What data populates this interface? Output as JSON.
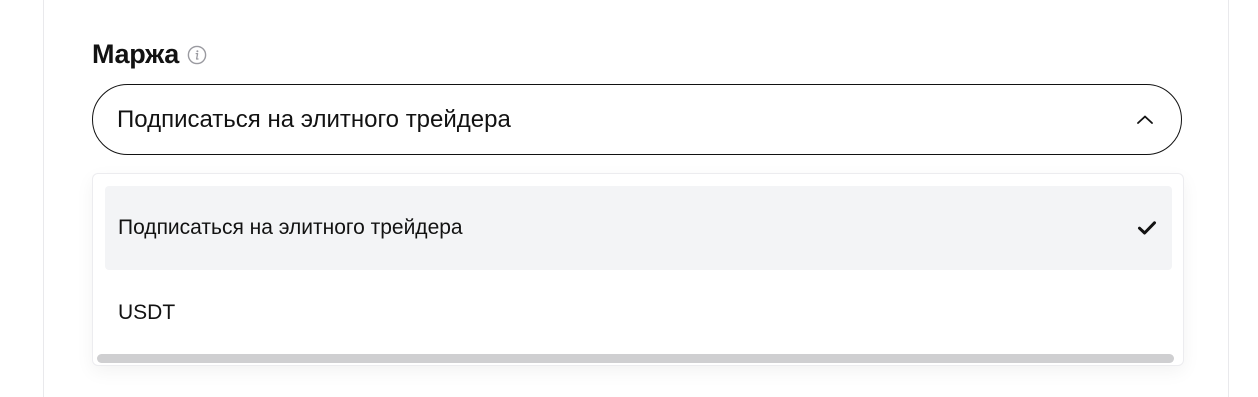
{
  "field": {
    "label": "Маржа",
    "info_icon": "info-icon",
    "selected_value": "Подписаться на элитного трейдера",
    "chevron_icon": "chevron-up-icon"
  },
  "dropdown": {
    "options": [
      {
        "label": "Подписаться на элитного трейдера",
        "selected": true,
        "icon": "check-icon"
      },
      {
        "label": "USDT",
        "selected": false
      }
    ]
  },
  "colors": {
    "text": "#121212",
    "border": "#121212",
    "selected_bg": "#f3f4f6",
    "muted_icon": "#9a9aa0",
    "scrollbar": "#cfcfd1"
  }
}
